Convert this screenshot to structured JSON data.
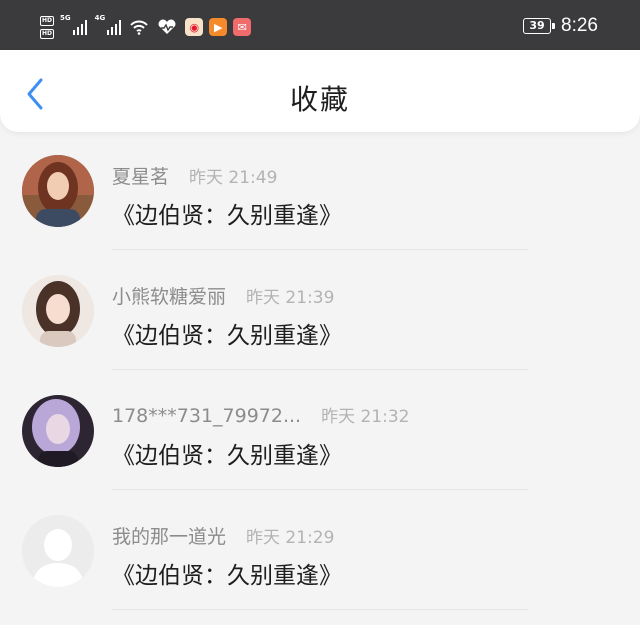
{
  "status_bar": {
    "hd_label": "HD",
    "network_1": "5G",
    "network_2": "4G",
    "battery": "39",
    "time": "8:26",
    "icons": [
      "signal-icon",
      "wifi-icon",
      "heart-icon",
      "weibo-icon",
      "video-icon",
      "mail-icon"
    ],
    "colors": {
      "weibo": "#e6162d",
      "video": "#f58a2b",
      "mail": "#f06b6b"
    }
  },
  "nav": {
    "title": "收藏",
    "back_icon": "chevron-left-icon",
    "accent": "#3d8ff2"
  },
  "favorites": [
    {
      "username": "夏星茗",
      "time": "昨天 21:49",
      "title": "《边伯贤：久别重逢》"
    },
    {
      "username": "小熊软糖爱丽",
      "time": "昨天 21:39",
      "title": "《边伯贤：久别重逢》"
    },
    {
      "username": "178***731_79972...",
      "time": "昨天 21:32",
      "title": "《边伯贤：久别重逢》"
    },
    {
      "username": "我的那一道光",
      "time": "昨天 21:29",
      "title": "《边伯贤：久别重逢》"
    }
  ]
}
